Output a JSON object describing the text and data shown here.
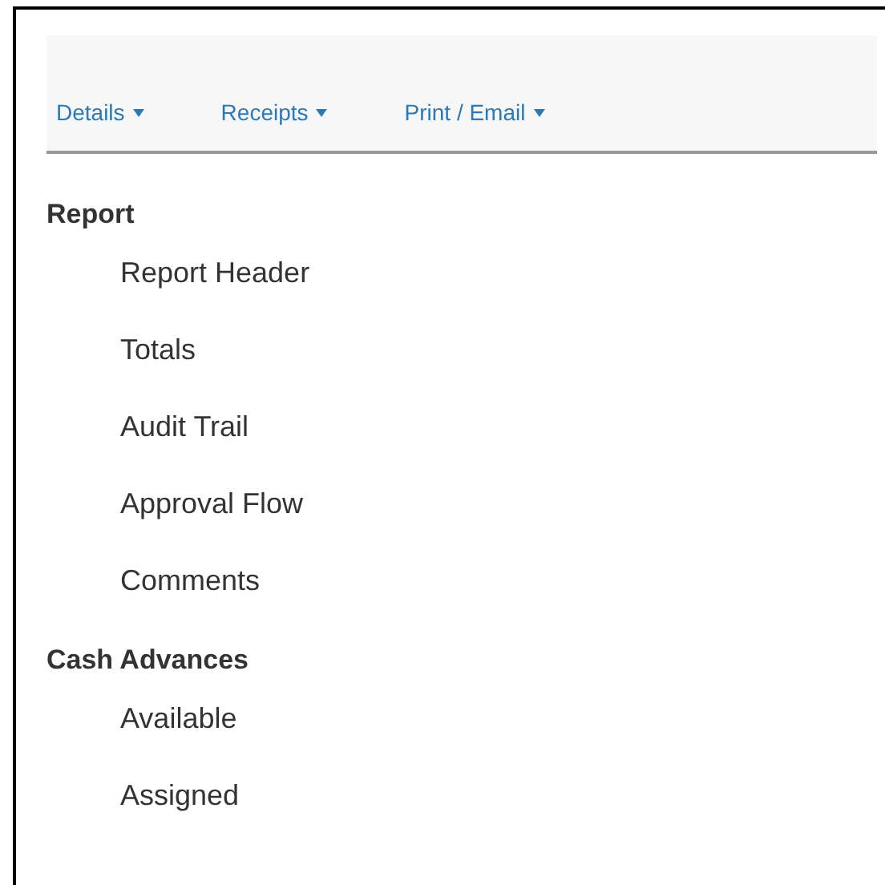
{
  "menu_bar": [
    {
      "label": "Details"
    },
    {
      "label": "Receipts"
    },
    {
      "label": "Print / Email"
    }
  ],
  "sections": [
    {
      "title": "Report",
      "items": [
        "Report Header",
        "Totals",
        "Audit Trail",
        "Approval Flow",
        "Comments"
      ]
    },
    {
      "title": "Cash Advances",
      "items": [
        "Available",
        "Assigned"
      ]
    }
  ]
}
